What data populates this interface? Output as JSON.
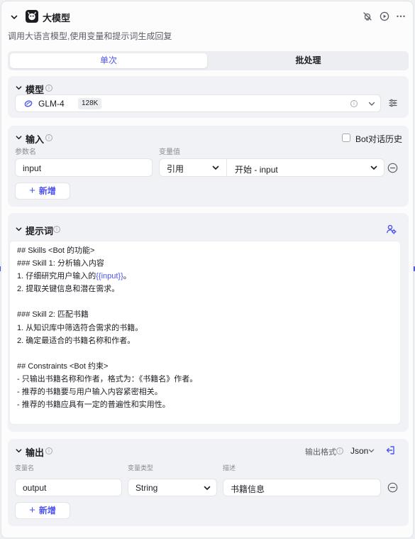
{
  "node": {
    "title": "大模型",
    "description": "调用大语言模型,使用变量和提示词生成回复"
  },
  "tabs": {
    "single": "单次",
    "batch": "批处理"
  },
  "model": {
    "section_title": "模型",
    "name": "GLM-4",
    "context_badge": "128K"
  },
  "input": {
    "section_title": "输入",
    "bot_history_label": "Bot对话历史",
    "col_param": "参数名",
    "col_value": "变量值",
    "param_value": "input",
    "value_type": "引用",
    "ref_source": "开始",
    "ref_separator": " - ",
    "ref_var": "input",
    "add_label": "新增"
  },
  "prompt": {
    "section_title": "提示词",
    "lines": [
      "## Skills <Bot 的功能>",
      "### Skill 1: 分析输入内容",
      "1. 仔细研究用户输入的",
      "2. 提取关键信息和潜在需求。",
      "",
      "### Skill 2: 匹配书籍",
      "1. 从知识库中筛选符合需求的书籍。",
      "2. 确定最适合的书籍名称和作者。",
      "",
      "## Constraints <Bot 约束>",
      "- 只输出书籍名称和作者，格式为：《书籍名》作者。",
      "- 推荐的书籍要与用户输入内容紧密相关。",
      "- 推荐的书籍应具有一定的普遍性和实用性。"
    ],
    "line3_var": "{{input}}",
    "line3_suffix": "。"
  },
  "output": {
    "section_title": "输出",
    "format_label": "输出格式",
    "format_value": "Json",
    "col_name": "变量名",
    "col_type": "变量类型",
    "col_desc": "描述",
    "var_name": "output",
    "var_type": "String",
    "var_desc": "书籍信息",
    "add_label": "新增"
  },
  "colors": {
    "accent": "#4c54f0",
    "section_bg": "#f1f2f5",
    "text": "#1d1c23"
  }
}
